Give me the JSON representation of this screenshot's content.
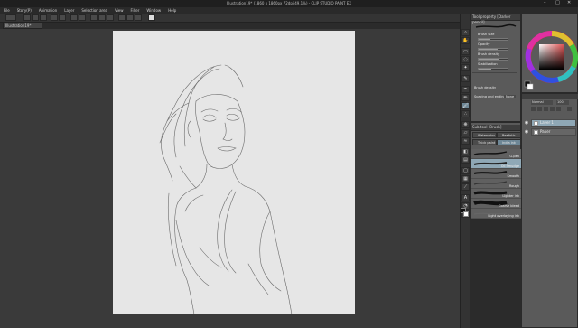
{
  "window": {
    "title": "Illustration19* (1860 x 1860px 72dpi 49.1%) - CLIP STUDIO PAINT EX",
    "minimize": "–",
    "maximize": "□",
    "close": "✕"
  },
  "menu": [
    "File",
    "Story(P)",
    "Animation",
    "Layer",
    "Selection area",
    "View",
    "Filter",
    "Window",
    "Help"
  ],
  "document_tab": "Illustration19*",
  "tool_property": {
    "title": "Tool property [Darker pencil]",
    "brush_size_label": "Brush Size",
    "brush_size_value": 0.4,
    "opacity_label": "Opacity",
    "opacity_value": 0.65,
    "brush_density_label": "Brush density",
    "brush_density_value": 0.7,
    "stabilization_label": "Stabilization",
    "stabilization_value": 0.45,
    "brush_density2_label": "Brush density",
    "spacing_label": "Spacing and ending",
    "spacing_value": "None"
  },
  "sub_tool": {
    "title": "Sub tool [Brush]",
    "tabs": [
      "Watercolor",
      "Realistic",
      "Thick paint",
      "India ink"
    ],
    "brushes": [
      {
        "label": "G-pen",
        "selected": false
      },
      {
        "label": "Oil Smudge",
        "selected": false
      },
      {
        "label": "Smooth",
        "selected": true
      },
      {
        "label": "Rough",
        "selected": false
      },
      {
        "label": "Lighter ink",
        "selected": false
      },
      {
        "label": "Coarse bleed",
        "selected": false
      },
      {
        "label": "Light overlaying ink",
        "selected": false
      }
    ]
  },
  "color": {
    "accent": "#e05050"
  },
  "layers": {
    "blend_mode": "Normal",
    "opacity": "100",
    "items": [
      {
        "name": "Layer 1",
        "selected": true
      },
      {
        "name": "Paper",
        "selected": false
      }
    ]
  }
}
